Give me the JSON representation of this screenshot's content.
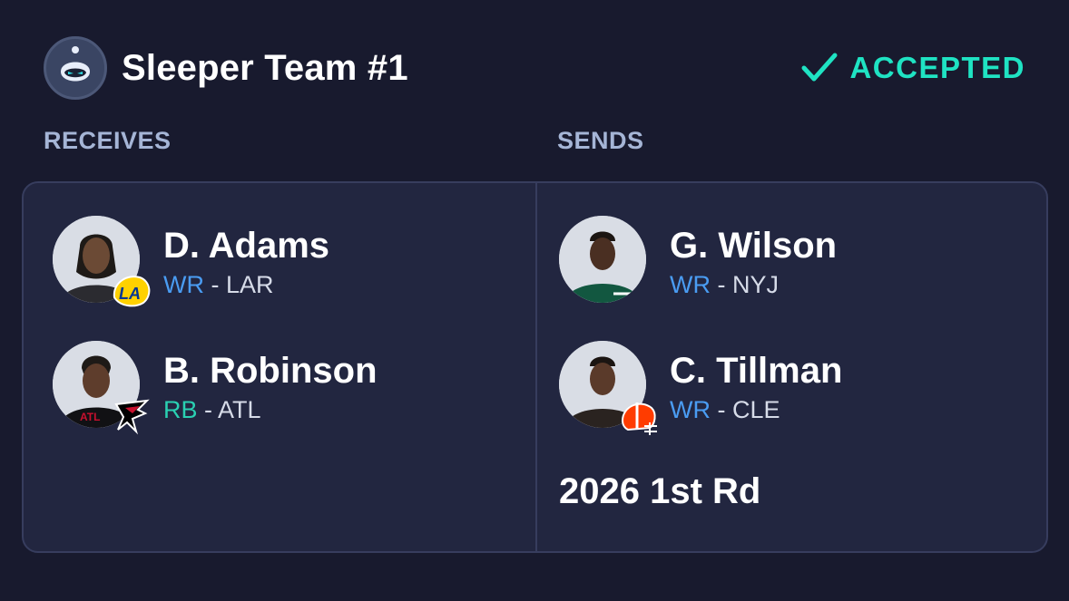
{
  "header": {
    "team_name": "Sleeper Team #1",
    "status": "ACCEPTED",
    "status_color": "#1fe3c3"
  },
  "columns": {
    "receives_label": "RECEIVES",
    "sends_label": "SENDS"
  },
  "receives": [
    {
      "name": "D. Adams",
      "position": "WR",
      "team": "- LAR",
      "team_logo": "rams-logo-icon"
    },
    {
      "name": "B. Robinson",
      "position": "RB",
      "team": "- ATL",
      "team_logo": "falcons-logo-icon"
    }
  ],
  "sends": [
    {
      "name": "G. Wilson",
      "position": "WR",
      "team": "- NYJ",
      "team_logo": "jets-logo-icon"
    },
    {
      "name": "C. Tillman",
      "position": "WR",
      "team": "- CLE",
      "team_logo": "browns-logo-icon"
    }
  ],
  "picks": {
    "sends_pick": "2026 1st Rd"
  },
  "colors": {
    "background": "#181a2e",
    "card": "#222640",
    "wr": "#4a9cf2",
    "rb": "#2ad0b2"
  }
}
